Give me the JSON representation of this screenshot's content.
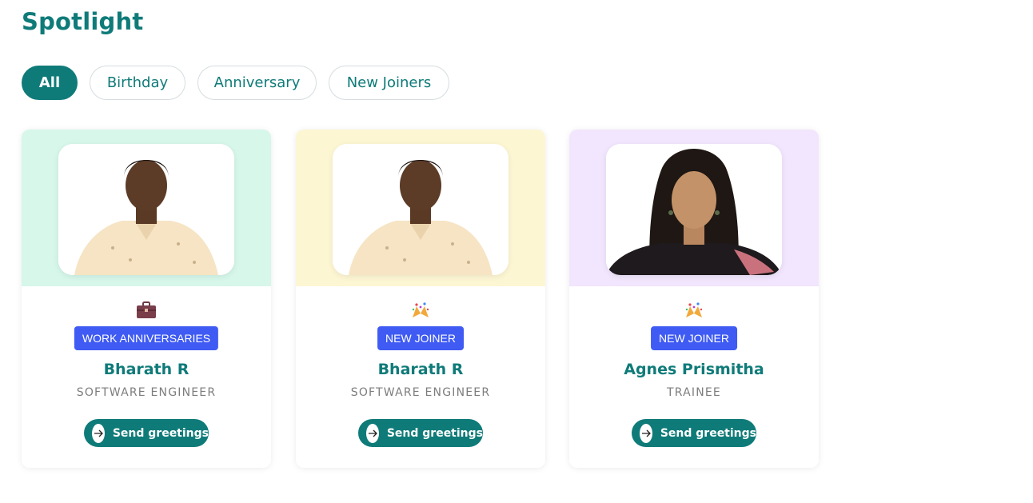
{
  "page": {
    "title": "Spotlight"
  },
  "filters": [
    {
      "label": "All",
      "active": true
    },
    {
      "label": "Birthday",
      "active": false
    },
    {
      "label": "Anniversary",
      "active": false
    },
    {
      "label": "New Joiners",
      "active": false
    }
  ],
  "cards": [
    {
      "name": "Bharath R",
      "role": "SOFTWARE ENGINEER",
      "badge": "WORK ANNIVERSARIES",
      "event_icon": "briefcase-icon",
      "bg_color": "#d6f7ea",
      "button_label": "Send greetings"
    },
    {
      "name": "Bharath R",
      "role": "SOFTWARE ENGINEER",
      "badge": "NEW JOINER",
      "event_icon": "party-popper-icon",
      "bg_color": "#fdf6d3",
      "button_label": "Send greetings"
    },
    {
      "name": "Agnes Prismitha",
      "role": "TRAINEE",
      "badge": "NEW JOINER",
      "event_icon": "party-popper-icon",
      "bg_color": "#f1e6fd",
      "button_label": "Send greetings"
    }
  ],
  "colors": {
    "brand": "#0f7b79",
    "badge": "#3f5bf3"
  }
}
